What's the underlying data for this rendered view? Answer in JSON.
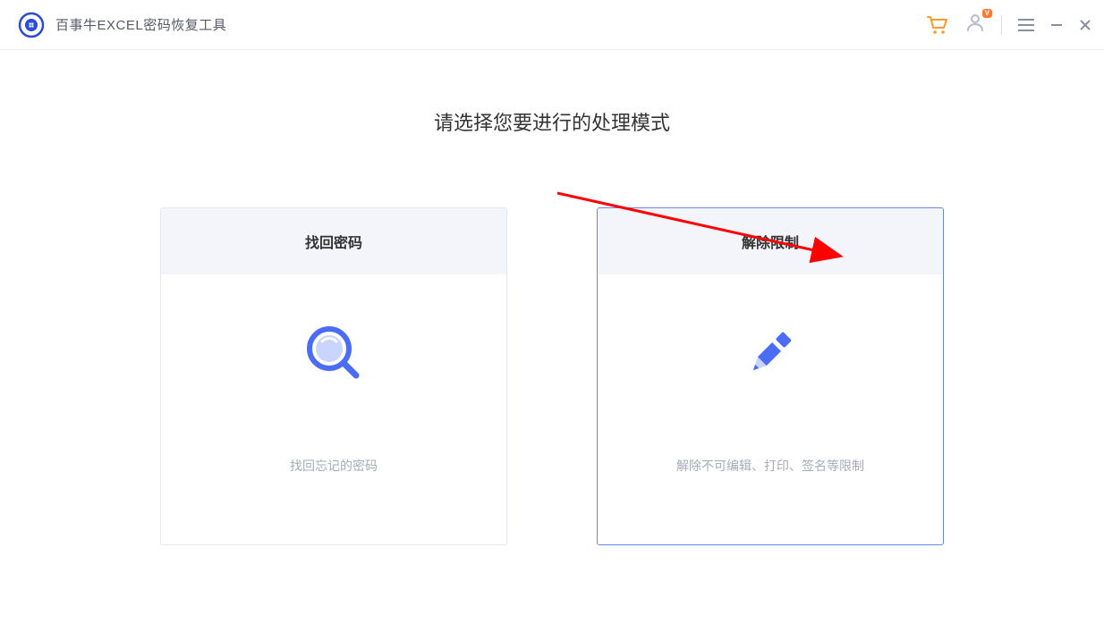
{
  "header": {
    "app_title": "百事牛EXCEL密码恢复工具",
    "vip_badge": "V"
  },
  "main": {
    "heading": "请选择您要进行的处理模式",
    "cards": [
      {
        "title": "找回密码",
        "desc": "找回忘记的密码"
      },
      {
        "title": "解除限制",
        "desc": "解除不可编辑、打印、签名等限制"
      }
    ]
  },
  "colors": {
    "accent": "#4a6cf7",
    "card_border_selected": "#6b86e8",
    "cart_orange": "#ff9a2d",
    "arrow_red": "#ff0000"
  }
}
